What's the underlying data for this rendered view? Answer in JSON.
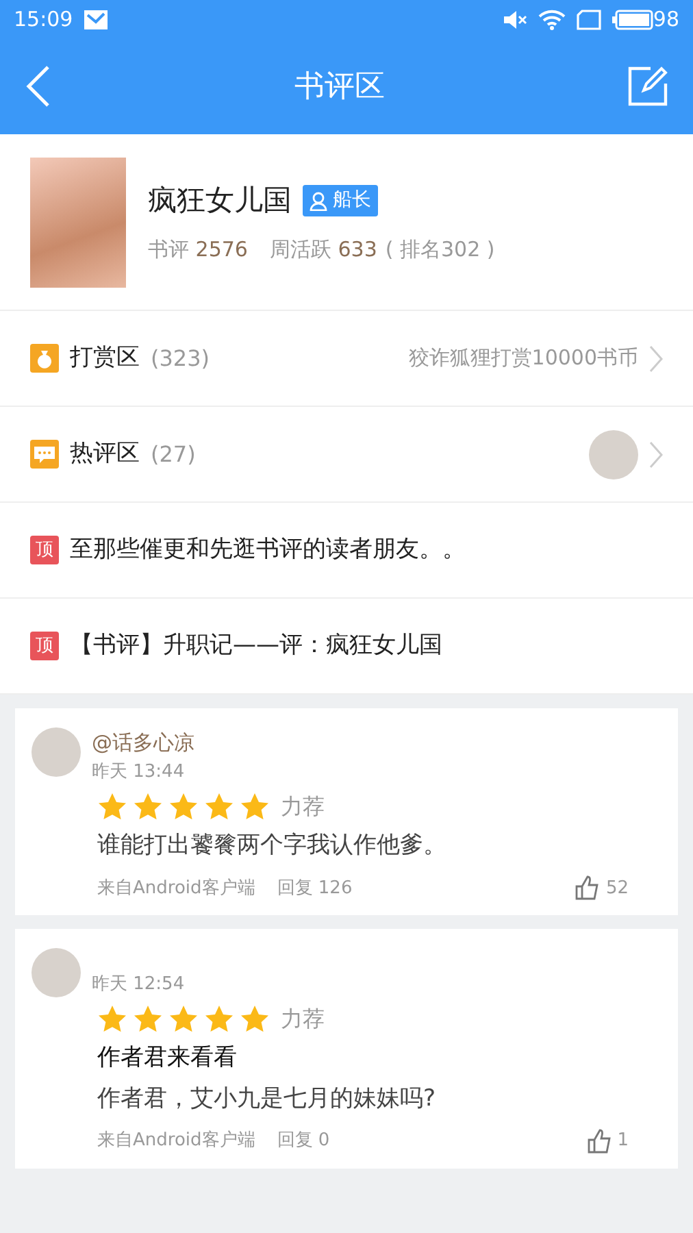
{
  "status_bar": {
    "time": "15:09",
    "battery": "98"
  },
  "nav": {
    "title": "书评区"
  },
  "book": {
    "title": "疯狂女儿国",
    "badge": "船长",
    "stats": [
      {
        "label": "书评",
        "value": "2576"
      },
      {
        "label": "周活跃",
        "value": "633"
      }
    ],
    "rank": "( 排名302 )"
  },
  "sections": [
    {
      "kind": "reward",
      "label": "打赏区",
      "count": "(323)",
      "note": "狡诈狐狸打赏10000书币"
    },
    {
      "kind": "hot",
      "label": "热评区",
      "count": "(27)"
    }
  ],
  "pinned": [
    {
      "tag": "顶",
      "title": "至那些催更和先逛书评的读者朋友。。"
    },
    {
      "tag": "顶",
      "title": "【书评】升职记——评：疯狂女儿国"
    }
  ],
  "reviews": [
    {
      "user": "@话多心凉",
      "time": "昨天 13:44",
      "stars": 5,
      "verdict": "力荐",
      "text": "谁能打出饕餮两个字我认作他爹。",
      "source": "来自Android客户端",
      "replies": "回复 126",
      "likes": "52"
    },
    {
      "time": "昨天 12:54",
      "stars": 5,
      "verdict": "力荐",
      "title": "作者君来看看",
      "text": "作者君，艾小九是七月的妹妹吗?",
      "source": "来自Android客户端",
      "replies": "回复 0",
      "likes": "1"
    }
  ]
}
